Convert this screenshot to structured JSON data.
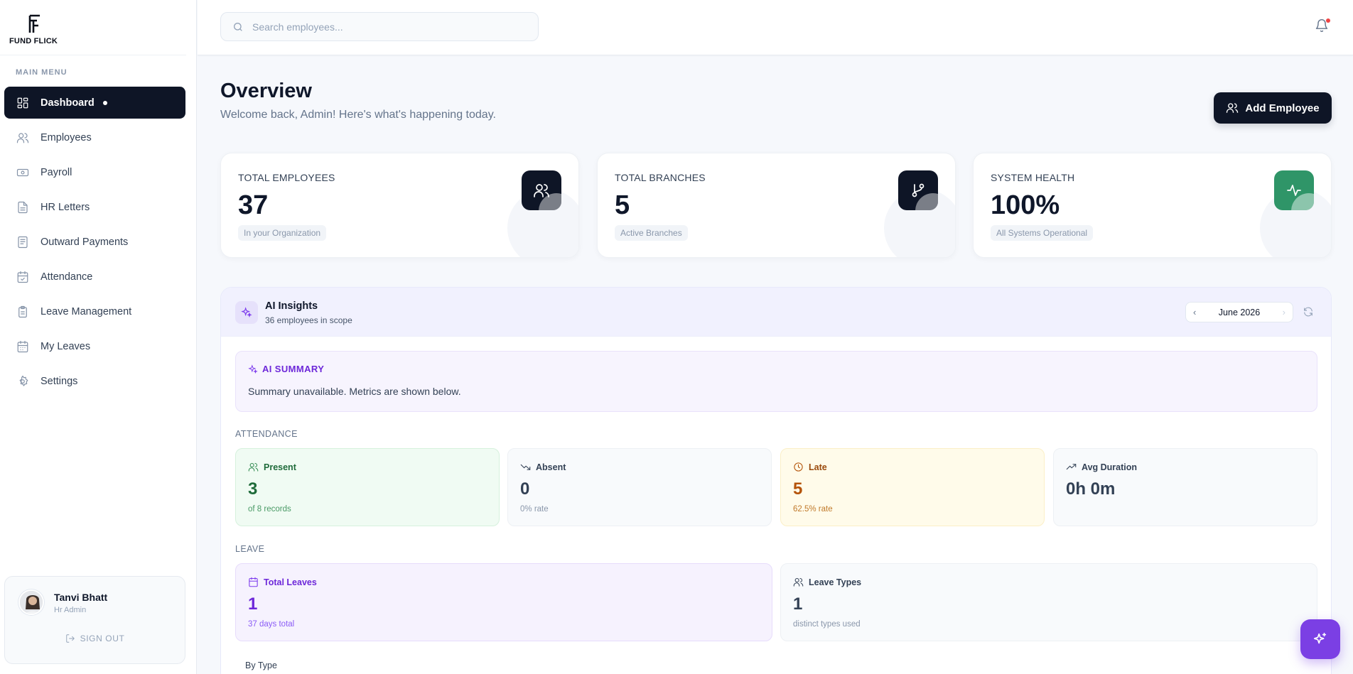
{
  "brand": {
    "name": "FUND FLICK",
    "logo_icon": "ff-monogram"
  },
  "sidebar": {
    "menu_title": "MAIN MENU",
    "items": [
      {
        "label": "Dashboard",
        "icon": "dashboard-grid-icon",
        "active": true
      },
      {
        "label": "Employees",
        "icon": "users-icon"
      },
      {
        "label": "Payroll",
        "icon": "banknote-icon"
      },
      {
        "label": "HR Letters",
        "icon": "document-icon"
      },
      {
        "label": "Outward Payments",
        "icon": "receipt-icon"
      },
      {
        "label": "Attendance",
        "icon": "calendar-check-icon"
      },
      {
        "label": "Leave Management",
        "icon": "clipboard-icon"
      },
      {
        "label": "My Leaves",
        "icon": "calendar-icon"
      },
      {
        "label": "Settings",
        "icon": "gear-icon"
      }
    ],
    "user": {
      "name": "Tanvi Bhatt",
      "role": "Hr Admin",
      "signout": "SIGN OUT"
    }
  },
  "topbar": {
    "search_placeholder": "Search employees...",
    "notification_dot": true
  },
  "header": {
    "title": "Overview",
    "subtitle": "Welcome back, Admin! Here's what's happening today.",
    "add_button": "Add Employee"
  },
  "stats": [
    {
      "label": "TOTAL EMPLOYEES",
      "value": "37",
      "note": "In your Organization",
      "icon": "users-icon"
    },
    {
      "label": "TOTAL BRANCHES",
      "value": "5",
      "note": "Active Branches",
      "icon": "git-branch-icon"
    },
    {
      "label": "SYSTEM HEALTH",
      "value": "100%",
      "note": "All Systems Operational",
      "icon": "activity-icon"
    }
  ],
  "ai": {
    "title": "AI Insights",
    "subtitle": "36 employees in scope",
    "month": "June 2026",
    "summary_title": "AI SUMMARY",
    "summary_text": "Summary unavailable. Metrics are shown below.",
    "attendance_label": "ATTENDANCE",
    "attendance": [
      {
        "label": "Present",
        "value": "3",
        "note": "of 8 records"
      },
      {
        "label": "Absent",
        "value": "0",
        "note": "0% rate"
      },
      {
        "label": "Late",
        "value": "5",
        "note": "62.5% rate"
      },
      {
        "label": "Avg Duration",
        "value": "0h 0m",
        "note": ""
      }
    ],
    "leave_label": "LEAVE",
    "leave": [
      {
        "label": "Total Leaves",
        "value": "1",
        "note": "37 days total"
      },
      {
        "label": "Leave Types",
        "value": "1",
        "note": "distinct types used"
      }
    ],
    "by_type_label": "By Type"
  },
  "colors": {
    "primary": "#0e1526",
    "accent": "#7b3fe4",
    "health": "#2f9568"
  }
}
